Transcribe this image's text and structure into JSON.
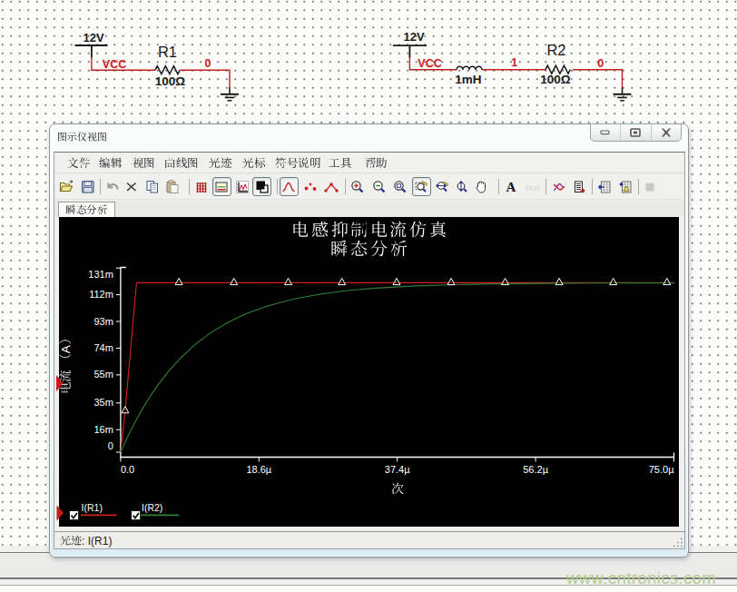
{
  "schematic": {
    "circuit1": {
      "source_voltage": "12V",
      "net_vcc": "VCC",
      "resistor_ref": "R1",
      "resistor_value": "100Ω",
      "net_out": "0"
    },
    "circuit2": {
      "source_voltage": "12V",
      "net_vcc": "VCC",
      "inductor_value": "1mH",
      "net_mid": "1",
      "resistor_ref": "R2",
      "resistor_value": "100Ω",
      "net_out": "0"
    }
  },
  "window": {
    "title": "图示仪视图",
    "controls": [
      {
        "name": "minimize"
      },
      {
        "name": "maximize"
      },
      {
        "name": "close"
      }
    ],
    "menu": [
      "文件",
      "编辑",
      "视图",
      "曲线图",
      "光迹",
      "光标",
      "符号说明",
      "工具",
      "帮助"
    ],
    "toolbar": [
      {
        "icon": "open-icon"
      },
      {
        "icon": "save-icon"
      },
      {
        "sep": true
      },
      {
        "icon": "undo-icon"
      },
      {
        "icon": "delete-icon"
      },
      {
        "icon": "copy-icon"
      },
      {
        "icon": "paste-icon"
      },
      {
        "sep": true
      },
      {
        "icon": "grid-icon"
      },
      {
        "icon": "legend-icon",
        "pressed": true
      },
      {
        "icon": "axes-properties-icon"
      },
      {
        "icon": "invert-colors-icon",
        "pressed": true
      },
      {
        "sep": true
      },
      {
        "icon": "trace-line-icon",
        "pressed": true
      },
      {
        "icon": "trace-dots-icon"
      },
      {
        "icon": "trace-dotline-icon"
      },
      {
        "sep": true
      },
      {
        "icon": "zoom-in-icon"
      },
      {
        "icon": "zoom-out-icon"
      },
      {
        "icon": "zoom-full-icon"
      },
      {
        "icon": "zoom-window-icon",
        "pressed": true
      },
      {
        "icon": "zoom-horizontal-icon"
      },
      {
        "icon": "zoom-vertical-icon"
      },
      {
        "icon": "pan-hand-icon"
      },
      {
        "sep": true
      },
      {
        "icon": "text-icon"
      },
      {
        "icon": "coordinates-icon",
        "disabled": true
      },
      {
        "sep": true
      },
      {
        "icon": "cursors-icon"
      },
      {
        "icon": "export-icon"
      },
      {
        "sep": true
      },
      {
        "icon": "export-excel-icon"
      },
      {
        "icon": "export-graph-icon"
      },
      {
        "sep": true
      },
      {
        "icon": "stop-icon",
        "disabled": true
      }
    ],
    "tab": "瞬态分析",
    "status": "光迹: I(R1)"
  },
  "chart_data": {
    "type": "line",
    "title": "电感抑制电流仿真",
    "subtitle": "瞬态分析",
    "xlabel": "次",
    "ylabel": "电流 （A）",
    "x_tick_labels": [
      "0.0",
      "18.6µ",
      "37.4µ",
      "56.2µ",
      "75.0µ"
    ],
    "x_tick_us": [
      0,
      18.75,
      37.5,
      56.25,
      75
    ],
    "y_tick_labels": [
      "0",
      "16m",
      "35m",
      "55m",
      "74m",
      "93m",
      "112m",
      "131m"
    ],
    "y_tick_ma": [
      0,
      16,
      35,
      55,
      74,
      93,
      112,
      131
    ],
    "xlim_us": [
      0,
      75
    ],
    "ylim_ma": [
      0,
      131
    ],
    "grid": false,
    "legend_position": "bottom",
    "series": [
      {
        "name": "I(R1)",
        "color": "#d42020",
        "points_t_us_ma": [
          [
            0,
            0
          ],
          [
            0.62,
            29.3
          ],
          [
            2.15,
            120.5
          ],
          [
            75,
            120.5
          ]
        ],
        "marker_t_us": [
          0.62,
          7.9,
          15.35,
          22.72,
          30.0,
          37.42,
          44.8,
          52.12,
          59.45,
          66.78,
          74.05
        ],
        "checked": true,
        "active": true
      },
      {
        "name": "I(R2)",
        "color": "#2f8032",
        "points_t_us_ma": [
          [
            0,
            0.0
          ],
          [
            1,
            11.47
          ],
          [
            2,
            21.84
          ],
          [
            3,
            31.23
          ],
          [
            4,
            39.73
          ],
          [
            5,
            47.41
          ],
          [
            6.5,
            57.59
          ],
          [
            8,
            66.36
          ],
          [
            10,
            76.17
          ],
          [
            12,
            84.21
          ],
          [
            14.5,
            92.23
          ],
          [
            17,
            98.49
          ],
          [
            20,
            104.19
          ],
          [
            23.5,
            109.01
          ],
          [
            27,
            112.4
          ],
          [
            31,
            115.07
          ],
          [
            35,
            116.86
          ],
          [
            40,
            118.29
          ],
          [
            45,
            119.16
          ],
          [
            51,
            119.77
          ],
          [
            57,
            120.1
          ],
          [
            64,
            120.3
          ],
          [
            70,
            120.39
          ],
          [
            75,
            120.43
          ]
        ],
        "marker_t_us": [],
        "checked": true,
        "active": false
      }
    ]
  },
  "watermark": "www.cntronics.com",
  "colors": {
    "wire": "#c02020",
    "net_label": "#cc1a1a",
    "component": "#1a1a1a",
    "chart_bg": "#000000",
    "chart_text": "#ffffff",
    "trace1": "#d42020",
    "trace2": "#2f8032",
    "watermark": "#bdd39b"
  }
}
